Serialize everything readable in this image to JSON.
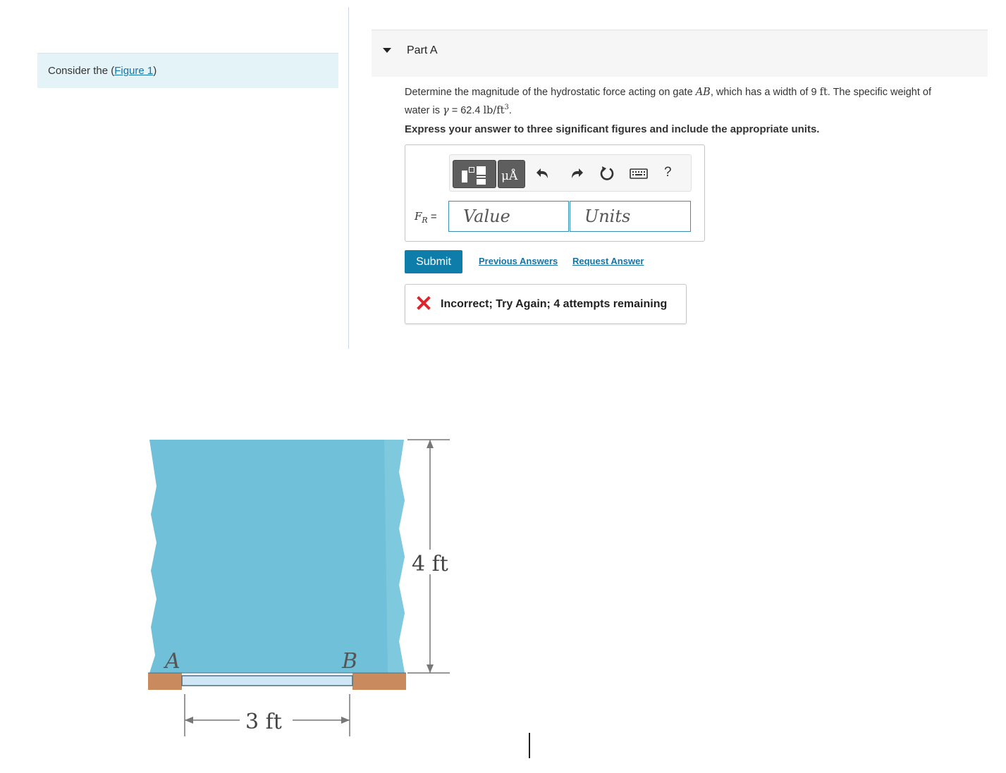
{
  "left_panel": {
    "consider_prefix": "Consider the (",
    "figure_link": "Figure 1",
    "consider_suffix": ")"
  },
  "part": {
    "title": "Part A"
  },
  "question": {
    "line1_prefix": "Determine the magnitude of the hydrostatic force acting on gate ",
    "gate_label": "AB",
    "line1_middle": ", which has a width of 9 ",
    "width_unit": "ft",
    "line1_suffix": ". The specific weight of",
    "line2_prefix": "water is ",
    "gamma_symbol": "γ",
    "gamma_value": " = 62.4 ",
    "gamma_unit": "lb/ft",
    "gamma_unit_exp": "3",
    "line2_suffix": "."
  },
  "instruction": "Express your answer to three significant figures and include the appropriate units.",
  "answer": {
    "label_main": "F",
    "label_sub": "R",
    "label_eq": " =",
    "value_placeholder": "Value",
    "units_placeholder": "Units",
    "toolbar": {
      "units_button": "μÅ",
      "help": "?",
      "icons": [
        "templates-icon",
        "units-icon",
        "undo-icon",
        "redo-icon",
        "reset-icon",
        "keyboard-icon",
        "help-icon"
      ]
    }
  },
  "actions": {
    "submit": "Submit",
    "previous_answers": "Previous Answers",
    "request_answer": "Request Answer"
  },
  "feedback": {
    "text": "Incorrect; Try Again; 4 attempts remaining",
    "icon": "x-icon",
    "color": "#e0242b"
  },
  "figure": {
    "label_a": "A",
    "label_b": "B",
    "depth_label": "4 ft",
    "gate_length_label": "3 ft",
    "water_color": "#6fc0d8",
    "ground_color": "#c98a5e",
    "gate_color": "#cfe7f4"
  },
  "colors": {
    "accent": "#0f7da9",
    "link": "#1574a6",
    "input_border": "#3a8fb7"
  }
}
